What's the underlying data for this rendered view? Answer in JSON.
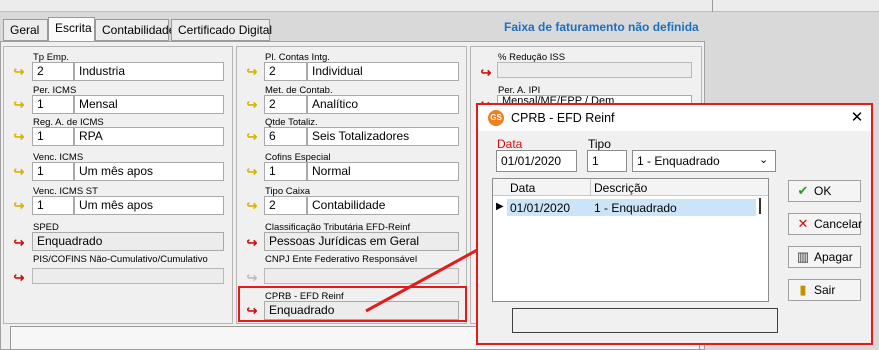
{
  "tabs": [
    "Geral",
    "Escrita",
    "Contabilidade",
    "Certificado Digital"
  ],
  "warning": "Faixa de faturamento não definida",
  "left_fields": {
    "tp_emp": {
      "label": "Tp Emp.",
      "code": "2",
      "value": "Industria"
    },
    "per_icms": {
      "label": "Per. ICMS",
      "code": "1",
      "value": "Mensal"
    },
    "reg_icms": {
      "label": "Reg. A. de ICMS",
      "code": "1",
      "value": "RPA"
    },
    "venc_icms": {
      "label": "Venc. ICMS",
      "code": "1",
      "value": "Um mês apos"
    },
    "venc_icms_st": {
      "label": "Venc. ICMS ST",
      "code": "1",
      "value": "Um mês apos"
    },
    "sped": {
      "label": "SPED",
      "value": "Enquadrado"
    },
    "pis_cofins": {
      "label": "PIS/COFINS Não-Cumulativo/Cumulativo",
      "value": ""
    }
  },
  "middle_fields": {
    "pl_contas": {
      "label": "Pl. Contas Intg.",
      "code": "2",
      "value": "Individual"
    },
    "met_contab": {
      "label": "Met. de Contab.",
      "code": "2",
      "value": "Analítico"
    },
    "qtde_totaliz": {
      "label": "Qtde Totaliz.",
      "code": "6",
      "value": "Seis Totalizadores"
    },
    "cofins_especial": {
      "label": "Cofins Especial",
      "code": "1",
      "value": "Normal"
    },
    "tipo_caixa": {
      "label": "Tipo Caixa",
      "code": "2",
      "value": "Contabilidade"
    },
    "class_trib": {
      "label": "Classificação Tributária EFD-Reinf",
      "value": "Pessoas Jurídicas em Geral"
    },
    "cnpj_ente": {
      "label": "CNPJ Ente Federativo Responsável",
      "value": ""
    },
    "cprb": {
      "label": "CPRB - EFD Reinf",
      "value": "Enquadrado"
    }
  },
  "right_fields": {
    "reducao_iss": {
      "label": "% Redução ISS",
      "value": ""
    },
    "per_ipi": {
      "label": "Per. A. IPI",
      "value": "Mensal/ME/EPP / Dem"
    }
  },
  "dialog": {
    "logo": "GS",
    "title": "CPRB - EFD Reinf",
    "data_label": "Data",
    "data_value": "01/01/2020",
    "tipo_label": "Tipo",
    "tipo_code": "1",
    "tipo_option": "1 - Enquadrado",
    "grid_headers": [
      "Data",
      "Descrição"
    ],
    "grid_row": {
      "date": "01/01/2020",
      "desc": "1 - Enquadrado"
    },
    "buttons": {
      "ok": "OK",
      "cancelar": "Cancelar",
      "apagar": "Apagar",
      "sair": "Sair"
    }
  },
  "colors": {
    "accent_red": "#e31b1b",
    "warning_blue": "#1e6fbf",
    "selection": "#cce4f7"
  },
  "icons": {
    "yellow_arrow": "↪",
    "red_arrow": "↪",
    "check": "✔",
    "cancel": "✕",
    "trash": "🗑",
    "exit": "⇥"
  }
}
